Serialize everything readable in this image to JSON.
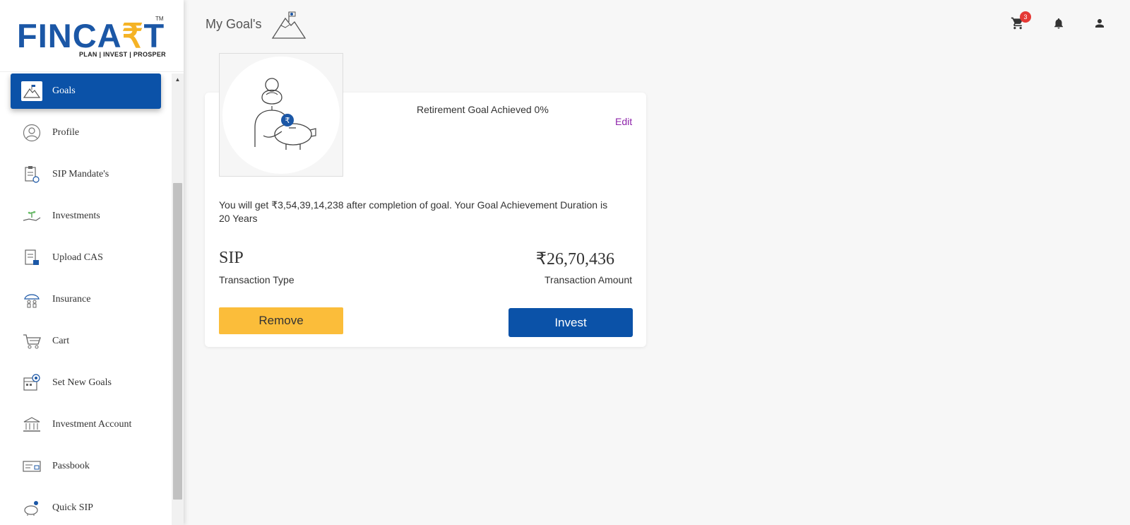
{
  "brand": {
    "name_part1": "FINCA",
    "name_part2": "₹",
    "name_part3": "T",
    "tm": "TM",
    "tagline": "PLAN | INVEST | PROSPER",
    "colors": {
      "blue": "#1b57a6",
      "gold": "#f5b325"
    }
  },
  "sidebar": {
    "items": [
      {
        "label": "Goals",
        "icon": "goals-mountain-icon",
        "active": true
      },
      {
        "label": "Profile",
        "icon": "profile-icon"
      },
      {
        "label": "SIP Mandate's",
        "icon": "clipboard-icon"
      },
      {
        "label": "Investments",
        "icon": "hand-plant-icon"
      },
      {
        "label": "Upload CAS",
        "icon": "document-icon"
      },
      {
        "label": "Insurance",
        "icon": "umbrella-family-icon"
      },
      {
        "label": "Cart",
        "icon": "cart-icon"
      },
      {
        "label": "Set New Goals",
        "icon": "target-calendar-icon"
      },
      {
        "label": "Investment Account",
        "icon": "bank-icon"
      },
      {
        "label": "Passbook",
        "icon": "passbook-icon"
      },
      {
        "label": "Quick SIP",
        "icon": "piggy-bank-icon"
      }
    ]
  },
  "header": {
    "title": "My Goal's",
    "cart_count": "3"
  },
  "goal_card": {
    "achieved_text": "Retirement Goal Achieved 0%",
    "edit_label": "Edit",
    "description": "You will get ₹3,54,39,14,238 after completion of goal. Your Goal Achievement Duration is 20 Years",
    "transaction_type_value": "SIP",
    "transaction_type_label": "Transaction Type",
    "transaction_amount_value": "₹26,70,436",
    "transaction_amount_label": "Transaction Amount",
    "remove_label": "Remove",
    "invest_label": "Invest"
  },
  "colors": {
    "primary": "#0b52a8",
    "accent_yellow": "#fbbd3a",
    "edit_purple": "#8e24aa",
    "badge_red": "#e53935"
  }
}
